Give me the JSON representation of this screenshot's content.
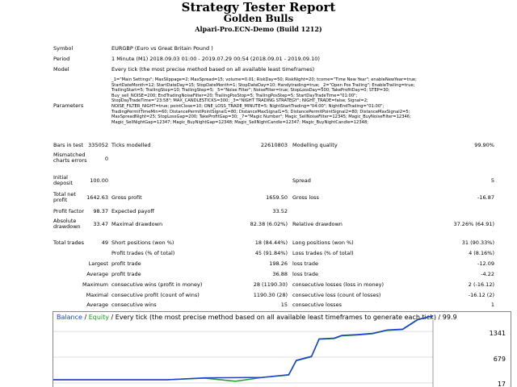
{
  "header": {
    "title": "Strategy Tester Report",
    "subtitle": "Golden Bulls",
    "server": "Alpari-Pro.ECN-Demo (Build 1212)"
  },
  "labels": {
    "symbol": "Symbol",
    "period": "Period",
    "model": "Model",
    "parameters": "Parameters",
    "bars_in_test": "Bars in test",
    "mismatched": "Mismatched charts errors",
    "initial_deposit": "Initial deposit",
    "total_net_profit": "Total net profit",
    "profit_factor": "Profit factor",
    "absolute_drawdown": "Absolute drawdown",
    "total_trades": "Total trades"
  },
  "values": {
    "symbol": "EURGBP (Euro vs Great Britain Pound )",
    "period": "1 Minute (M1) 2018.09.03 01:00 - 2019.07.29 00:54 (2018.09.01 - 2019.09.10)",
    "model": "Every tick (the most precise method based on all available least timeframes)",
    "bars_in_test": "335052",
    "ticks_modelled_label": "Ticks modelled",
    "ticks_modelled": "22610803",
    "modelling_quality_label": "Modelling quality",
    "modelling_quality": "99.90%",
    "mismatched": "0",
    "initial_deposit": "100.00",
    "spread_label": "Spread",
    "spread": "5",
    "total_net_profit": "1642.63",
    "gross_profit_label": "Gross profit",
    "gross_profit": "1659.50",
    "gross_loss_label": "Gross loss",
    "gross_loss": "-16.87",
    "profit_factor": "98.37",
    "expected_payoff_label": "Expected payoff",
    "expected_payoff": "33.52",
    "absolute_drawdown": "33.47",
    "maximal_drawdown_label": "Maximal drawdown",
    "maximal_drawdown": "82.38 (6.02%)",
    "relative_drawdown_label": "Relative drawdown",
    "relative_drawdown": "37.26% (64.91)",
    "total_trades": "49",
    "short_positions_label": "Short positions (won %)",
    "short_positions": "18 (84.44%)",
    "long_positions_label": "Long positions (won %)",
    "long_positions": "31 (90.33%)",
    "profit_trades_label": "Profit trades (% of total)",
    "profit_trades": "45 (91.84%)",
    "loss_trades_label": "Loss trades (% of total)",
    "loss_trades": "4 (8.16%)",
    "largest": "Largest",
    "largest_profit_label": "profit trade",
    "largest_profit": "198.26",
    "largest_loss_label": "loss trade",
    "largest_loss": "-12.09",
    "average": "Average",
    "average_profit_label": "profit trade",
    "average_profit": "36.88",
    "average_loss_label": "loss trade",
    "average_loss": "-4.22",
    "maximum": "Maximum",
    "max_consec_wins_label": "consecutive wins (profit in money)",
    "max_consec_wins": "28 (1190.30)",
    "max_consec_losses_label": "consecutive losses (loss in money)",
    "max_consec_losses": "2 (-16.12)",
    "maximal": "Maximal",
    "maximal_consec_profit_label": "consecutive profit (count of wins)",
    "maximal_consec_profit": "1190.30 (28)",
    "maximal_consec_loss_label": "consecutive loss (count of losses)",
    "maximal_consec_loss": "-16.12 (2)",
    "average2": "Average",
    "avg_consec_wins_label": "consecutive wins",
    "avg_consec_wins": "15",
    "avg_consec_losses_label": "consecutive losses",
    "avg_consec_losses": "1"
  },
  "parameters": [
    "_1=\"Main Settings\"; MaxSlippage=2; MaxSpread=15; volume=0.01; RiskDay=50; RiskNight=20; tcome=\"Time New Year\"; enableNewYear=true;",
    "StartDateMonth=12; StartDateDay=15; StopDateMonth=1; StopDateDay=10; Handytrading=true; _2=\"Open Pos Trailing\"; EnableTrailing=true;",
    "TrailingStart=5; TrailingStop=10; TrailingStep=5; _5=\"Noise Filter\"; NoiseFilter=true; StopLossDay=500; TakeProfitDay=0; STEP=30;",
    "Buy_sell_NOISE=200; EndTradingNoiseFilter=20; TrailingPosStop=5; TrailingPosStep=5; StartDayTradeTime=\"01:00\";",
    "StopDayTradeTime=\"23:58\"; MAX_CANDLESTICKS=300; _3=\"NIGHT TRADING STRATEGY\"; NIGHT_TRADE=false; Signal=2;",
    "NOISE_FILTER_NIGHT=true; pointClose=10; ONE_LOSS_TRADE_MINUTE=5; NightStartTrading=\"04:00\"; NightEndTrading=\"01:00\";",
    "TradingPermitTimeMin=60; DistancePermitPointSignal1=80; DistanceMaxSignal1=5; DistancePermitPointSignal2=80; DistanceMaxSignal2=5;",
    "MaxSpreadNight=25; StopLossGap=200; TakeProfitGap=30; _7=\"Magic Number\"; Magic_SellNoiseFilter=12345; Magic_BuyNoiseFilter=12346;",
    "Magic_SellNightGap=12347; Magic_BuyNightGap=12348; Magic_SellNightCandle=12347; Magic_BuyNightCandle=12348;"
  ],
  "chart": {
    "caption_balance": "Balance",
    "caption_sep": " / ",
    "caption_equity": "Equity",
    "caption_rest": " / Every tick (the most precise method based on all available least timeframes to generate each tick) / 99.9",
    "y_labels": [
      "1341",
      "679",
      "17"
    ],
    "balance_color": "#1f3fd0",
    "equity_color": "#1fa01f"
  },
  "chart_data": {
    "type": "line",
    "title": "",
    "xlabel": "",
    "ylabel": "",
    "ylim": [
      17,
      1550
    ],
    "yticks": [
      1341,
      679,
      17
    ],
    "series": [
      {
        "name": "Balance",
        "x": [
          0,
          30,
          40,
          55,
          62,
          64,
          68,
          70,
          74,
          76,
          80,
          84,
          88,
          92,
          96,
          100
        ],
        "values": [
          100,
          100,
          150,
          160,
          230,
          600,
          700,
          1150,
          1170,
          1240,
          1260,
          1290,
          1380,
          1400,
          1650,
          1742
        ]
      },
      {
        "name": "Equity",
        "x": [
          0,
          30,
          40,
          48,
          55,
          62,
          64,
          68,
          70,
          74,
          76,
          80,
          84,
          88,
          92,
          96,
          100
        ],
        "values": [
          100,
          100,
          140,
          60,
          160,
          220,
          590,
          690,
          1140,
          1160,
          1230,
          1250,
          1280,
          1370,
          1390,
          1640,
          1742
        ]
      }
    ]
  }
}
